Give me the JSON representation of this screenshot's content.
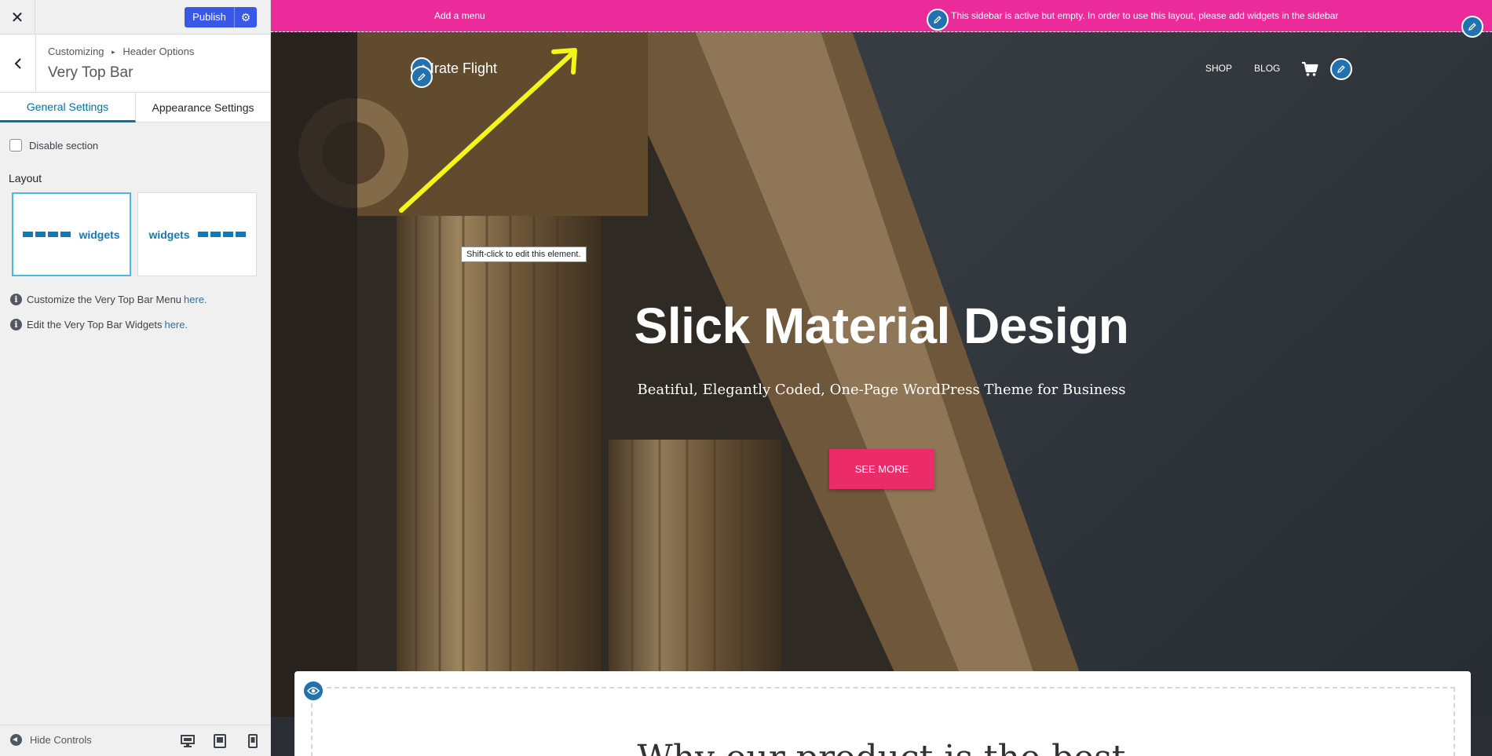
{
  "sidebar": {
    "publish_label": "Publish",
    "breadcrumb": {
      "parent": "Customizing",
      "child": "Header Options"
    },
    "section_title": "Very Top Bar",
    "tabs": [
      {
        "label": "General Settings",
        "active": true
      },
      {
        "label": "Appearance Settings",
        "active": false
      }
    ],
    "disable_label": "Disable section",
    "disable_checked": false,
    "layout_label": "Layout",
    "layout_options": [
      {
        "label": "widgets",
        "order": "menu-first",
        "selected": true
      },
      {
        "label": "widgets",
        "order": "widgets-first",
        "selected": false
      }
    ],
    "info": [
      {
        "text": "Customize the Very Top Bar Menu",
        "link": "here."
      },
      {
        "text": "Edit the Very Top Bar Widgets",
        "link": "here."
      }
    ],
    "footer": {
      "hide_controls": "Hide Controls",
      "devices": [
        "desktop-icon",
        "tablet-icon",
        "mobile-icon"
      ]
    }
  },
  "preview": {
    "top_bar": {
      "add_menu": "Add a menu",
      "sidebar_message": "This sidebar is active but empty. In order to use this layout, please add widgets in the sidebar"
    },
    "site_title": "Irate Flight",
    "nav": [
      "SHOP",
      "BLOG"
    ],
    "tooltip": "Shift-click to edit this element.",
    "hero": {
      "title": "Slick Material Design",
      "subtitle": "Beatiful, Elegantly Coded, One-Page WordPress Theme for Business",
      "button": "SEE MORE"
    },
    "section_heading": "Why our product is the best"
  },
  "colors": {
    "accent_pink": "#ec2b9b",
    "button_pink": "#ec2b6b",
    "wp_blue": "#2271b1",
    "publish_blue": "#3858e9",
    "annotation_arrow": "#f5f519"
  }
}
